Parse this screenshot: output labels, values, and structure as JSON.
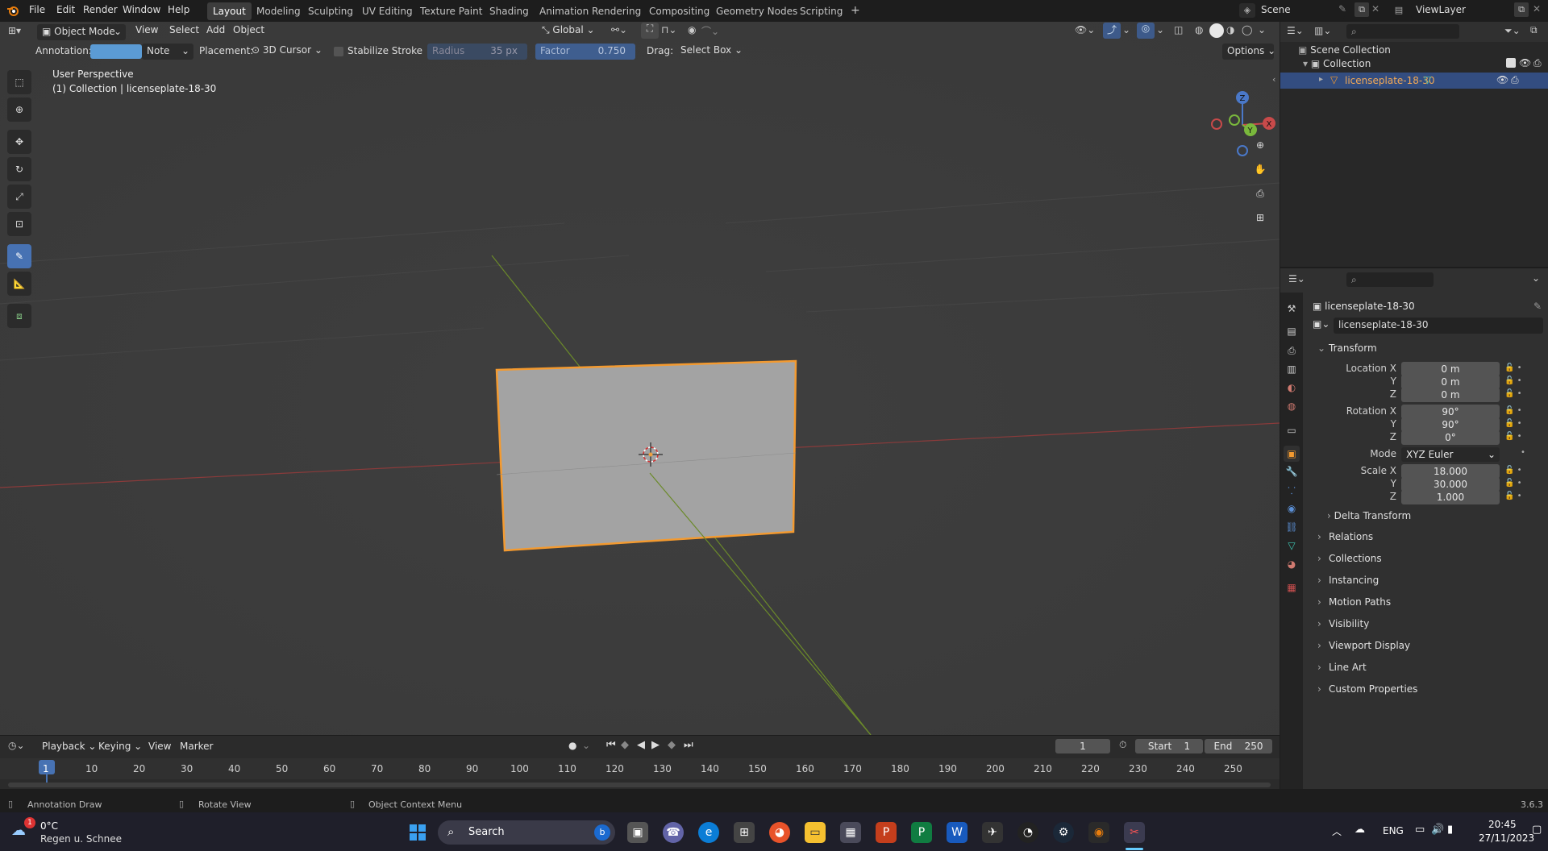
{
  "topbar": {
    "menus": [
      "File",
      "Edit",
      "Render",
      "Window",
      "Help"
    ],
    "workspaces": [
      "Layout",
      "Modeling",
      "Sculpting",
      "UV Editing",
      "Texture Paint",
      "Shading",
      "Animation",
      "Rendering",
      "Compositing",
      "Geometry Nodes",
      "Scripting"
    ],
    "active_workspace": "Layout",
    "add_tab": "+",
    "scene": "Scene",
    "view_layer": "ViewLayer"
  },
  "viewport_header": {
    "mode": "Object Mode",
    "menus": [
      "View",
      "Select",
      "Add",
      "Object"
    ],
    "orientation": "Global"
  },
  "tool_settings": {
    "annotation_label": "Annotation:",
    "annotation_color": "#5b9bd5",
    "note": "Note",
    "placement_label": "Placement:",
    "placement": "3D Cursor",
    "stabilize": "Stabilize Stroke",
    "radius_label": "Radius",
    "radius_value": "35 px",
    "factor_label": "Factor",
    "factor_value": "0.750",
    "drag_label": "Drag:",
    "drag_value": "Select Box",
    "options": "Options"
  },
  "viewport": {
    "perspective": "User Perspective",
    "collection_info": "(1) Collection | licenseplate-18-30"
  },
  "outliner": {
    "scene_collection": "Scene Collection",
    "collection": "Collection",
    "object": "licenseplate-18-30"
  },
  "properties": {
    "object_title": "licenseplate-18-30",
    "object_name": "licenseplate-18-30",
    "transform_label": "Transform",
    "location_label": "Location X",
    "location": [
      "0 m",
      "0 m",
      "0 m"
    ],
    "rotation_label": "Rotation X",
    "rotation": [
      "90°",
      "90°",
      "0°"
    ],
    "mode_label": "Mode",
    "mode": "XYZ Euler",
    "scale_label": "Scale X",
    "scale": [
      "18.000",
      "30.000",
      "1.000"
    ],
    "axis_y": "Y",
    "axis_z": "Z",
    "delta_transform": "Delta Transform",
    "panels": [
      "Relations",
      "Collections",
      "Instancing",
      "Motion Paths",
      "Visibility",
      "Viewport Display",
      "Line Art",
      "Custom Properties"
    ]
  },
  "timeline": {
    "menus": [
      "Playback",
      "Keying",
      "View",
      "Marker"
    ],
    "current_frame": "1",
    "start_label": "Start",
    "start": "1",
    "end_label": "End",
    "end": "250",
    "ticks": [
      "1",
      "10",
      "20",
      "30",
      "40",
      "50",
      "60",
      "70",
      "80",
      "90",
      "100",
      "110",
      "120",
      "130",
      "140",
      "150",
      "160",
      "170",
      "180",
      "190",
      "200",
      "210",
      "220",
      "230",
      "240",
      "250"
    ]
  },
  "statusbar": {
    "left": "Annotation Draw",
    "middle": "Rotate View",
    "right": "Object Context Menu",
    "version": "3.6.3"
  },
  "taskbar": {
    "weather_temp": "0°C",
    "weather_desc": "Regen u. Schnee",
    "weather_badge": "1",
    "search": "Search",
    "language": "ENG",
    "time": "20:45",
    "date": "27/11/2023"
  }
}
